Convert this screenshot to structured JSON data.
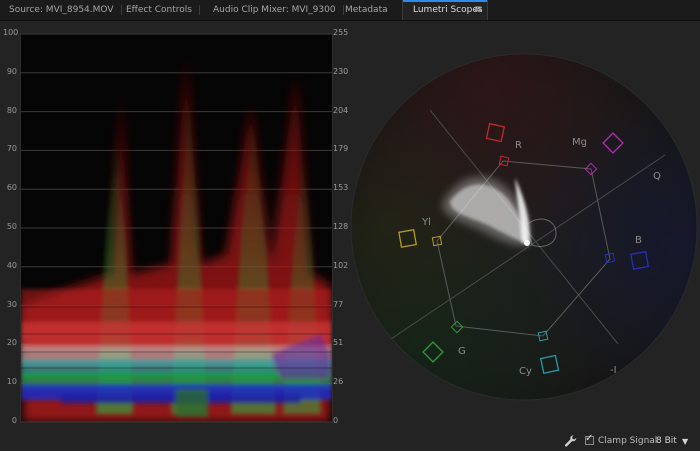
{
  "tabs": [
    {
      "label": "Source: MVI_8954.MOV",
      "active": false
    },
    {
      "label": "Effect Controls",
      "active": false
    },
    {
      "label": "Audio Clip Mixer: MVI_9300",
      "active": false
    },
    {
      "label": "Metadata",
      "active": false
    },
    {
      "label": "Lumetri Scopes",
      "active": true
    }
  ],
  "tab_menu_icon": "hamburger-menu-icon",
  "waveform": {
    "left_scale": [
      "100",
      "90",
      "80",
      "70",
      "60",
      "50",
      "40",
      "30",
      "20",
      "10",
      "0"
    ],
    "right_scale": [
      "255",
      "230",
      "204",
      "179",
      "153",
      "128",
      "102",
      "77",
      "51",
      "26",
      "0"
    ]
  },
  "vectorscope": {
    "labels": {
      "R": "R",
      "Mg": "Mg",
      "Q": "Q",
      "B": "B",
      "Yl": "Yl",
      "G": "G",
      "Cy": "Cy",
      "I": "-I"
    }
  },
  "bottom": {
    "settings_icon": "wrench-icon",
    "clamp_checked": true,
    "clamp_label": "Clamp Signal",
    "bit_depth": "8 Bit",
    "caret_icon": "chevron-down-icon"
  },
  "colors": {
    "accent": "#2d8ceb",
    "red": "#c0282d",
    "magenta": "#b02cb0",
    "blue": "#2630b8",
    "yellow": "#b89a22",
    "green": "#2e9a3a",
    "cyan": "#2a9aa8"
  }
}
